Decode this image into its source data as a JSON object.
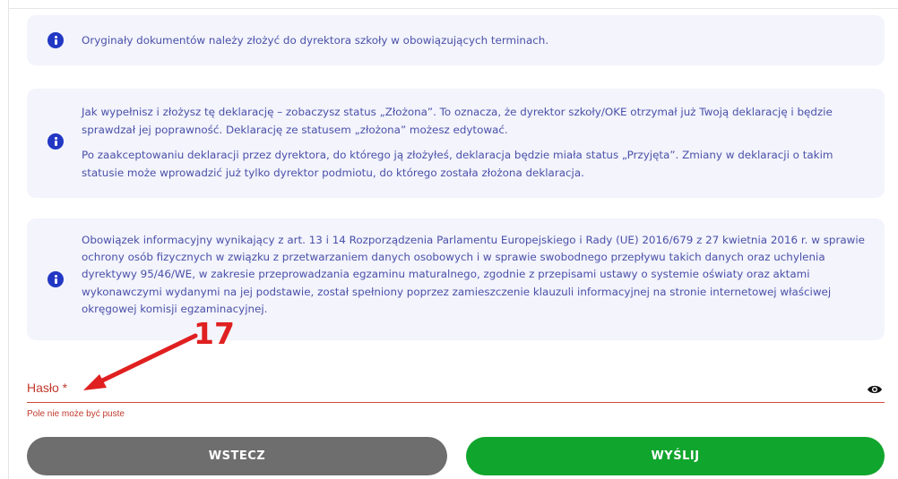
{
  "info_boxes": [
    {
      "paragraphs": [
        "Oryginały dokumentów należy złożyć do dyrektora szkoły w obowiązujących terminach."
      ]
    },
    {
      "paragraphs": [
        "Jak wypełnisz i złożysz tę deklarację – zobaczysz status „Złożona”. To oznacza, że dyrektor szkoły/OKE otrzymał już Twoją deklarację i będzie sprawdzał jej poprawność. Deklarację ze statusem „złożona” możesz edytować.",
        "Po zaakceptowaniu deklaracji przez dyrektora, do którego ją złożyłeś, deklaracja będzie miała status „Przyjęta”. Zmiany w deklaracji o takim statusie może wprowadzić już tylko dyrektor podmiotu, do którego została złożona deklaracja."
      ]
    },
    {
      "paragraphs": [
        "Obowiązek informacyjny wynikający z art. 13 i 14 Rozporządzenia Parlamentu Europejskiego i Rady (UE) 2016/679 z 27 kwietnia 2016 r. w sprawie ochrony osób fizycznych w związku z przetwarzaniem danych osobowych i w sprawie swobodnego przepływu takich danych oraz uchylenia dyrektywy 95/46/WE, w zakresie przeprowadzania egzaminu maturalnego, zgodnie z przepisami ustawy o systemie oświaty oraz aktami wykonawczymi wydanymi na jej podstawie, został spełniony poprzez zamieszczenie klauzuli informacyjnej na stronie internetowej właściwej okręgowej komisji egzaminacyjnej."
      ]
    }
  ],
  "annotation": {
    "number": "17",
    "color": "#e02020"
  },
  "password_field": {
    "label": "Hasło *",
    "value": "",
    "error": "Pole nie może być puste",
    "toggle_icon": "eye-icon",
    "error_color": "#c0392b"
  },
  "buttons": {
    "back_label": "WSTECZ",
    "send_label": "WYŚLIJ",
    "back_color": "#6e6e6e",
    "send_color": "#10a52d"
  },
  "colors": {
    "info_bg": "#f3f4fc",
    "info_text": "#4a50a8",
    "info_icon": "#2238c4"
  }
}
